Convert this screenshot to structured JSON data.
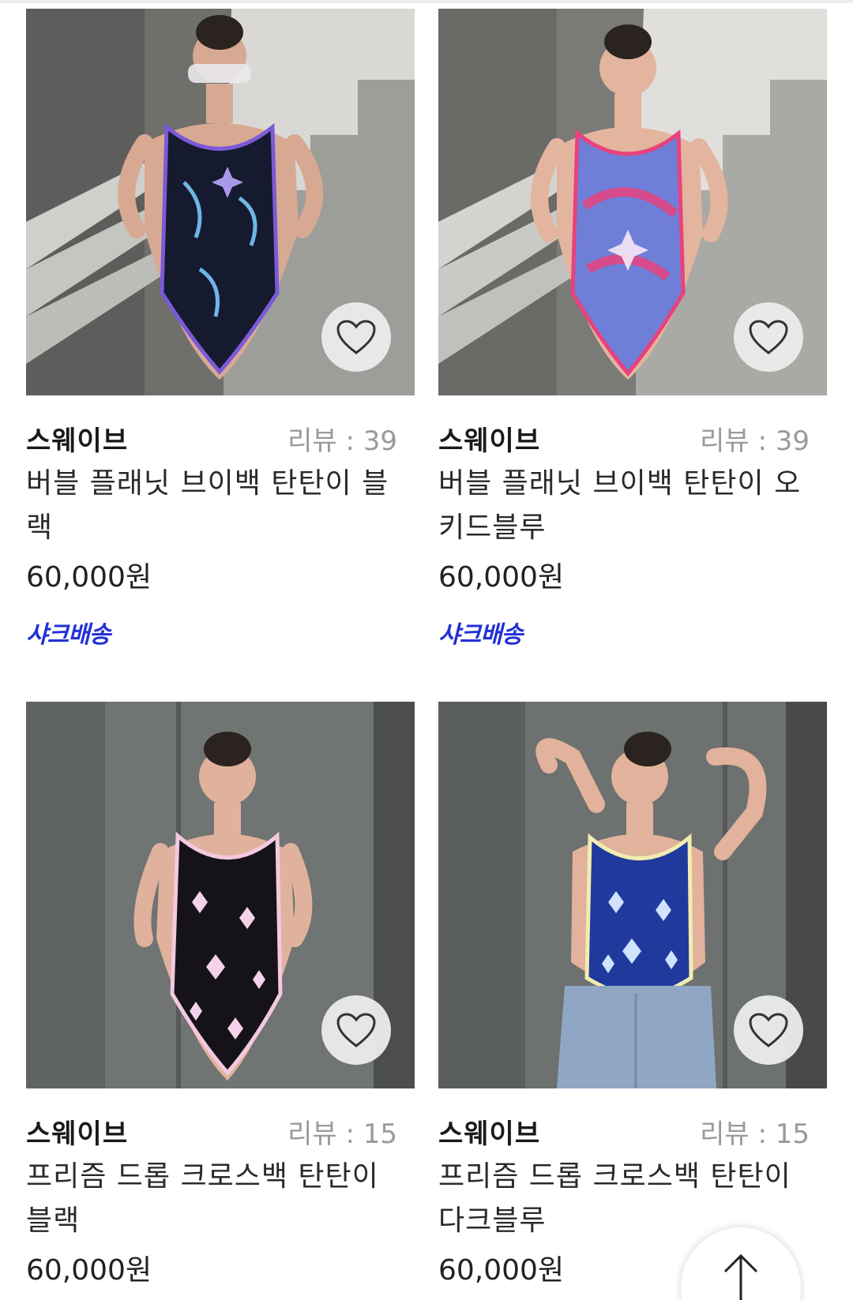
{
  "products": [
    {
      "brand": "스웨이브",
      "review": "리뷰 : 39",
      "name": "버블 플래닛 브이백 탄탄이 블랙",
      "price": "60,000원",
      "badge": "샤크배송",
      "colors": {
        "suit": "#151a2e",
        "trim": "#7b5ad8",
        "accent": "#6fb6e6"
      }
    },
    {
      "brand": "스웨이브",
      "review": "리뷰 : 39",
      "name": "버블 플래닛 브이백 탄탄이 오키드블루",
      "price": "60,000원",
      "badge": "샤크배송",
      "colors": {
        "suit": "#6f7fd8",
        "trim": "#e8427e",
        "accent": "#f08fc0"
      }
    },
    {
      "brand": "스웨이브",
      "review": "리뷰 : 15",
      "name": "프리즘 드롭 크로스백 탄탄이 블랙",
      "price": "60,000원",
      "badge": "",
      "colors": {
        "suit": "#151318",
        "trim": "#f3c9e0",
        "accent": "#f3d2ea"
      }
    },
    {
      "brand": "스웨이브",
      "review": "리뷰 : 15",
      "name": "프리즘 드롭 크로스백 탄탄이 다크블루",
      "price": "60,000원",
      "badge": "",
      "colors": {
        "suit": "#1f3a9c",
        "trim": "#f2ecb0",
        "accent": "#cfe3ff"
      }
    }
  ],
  "icons": {
    "favorite": "heart-outline-icon",
    "scroll_top": "arrow-up-icon"
  }
}
